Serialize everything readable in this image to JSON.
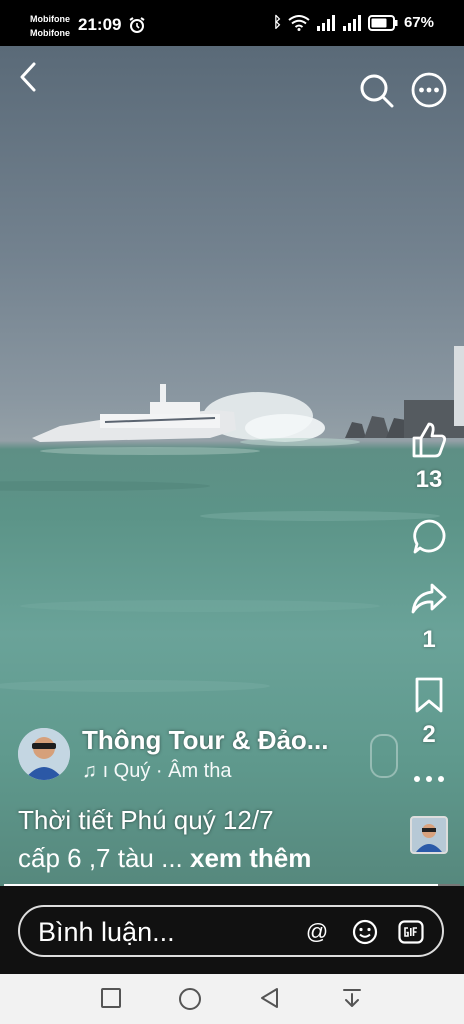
{
  "status": {
    "carrier1": "Mobifone",
    "carrier2": "Mobifone",
    "time": "21:09",
    "battery": "67%"
  },
  "actions": {
    "like_count": "13",
    "share_count": "1",
    "save_count": "2"
  },
  "post": {
    "author": "Thông Tour & Đảo...",
    "music": "ı Quý · Âm tha",
    "caption_line1": "Thời tiết Phú quý 12/7",
    "caption_line2": "cấp 6 ,7 tàu ... ",
    "see_more": "xem thêm"
  },
  "comment": {
    "placeholder": "Bình luận..."
  },
  "colors": {
    "progress": "#ffffff",
    "nav_bg": "#f2f2f2"
  }
}
